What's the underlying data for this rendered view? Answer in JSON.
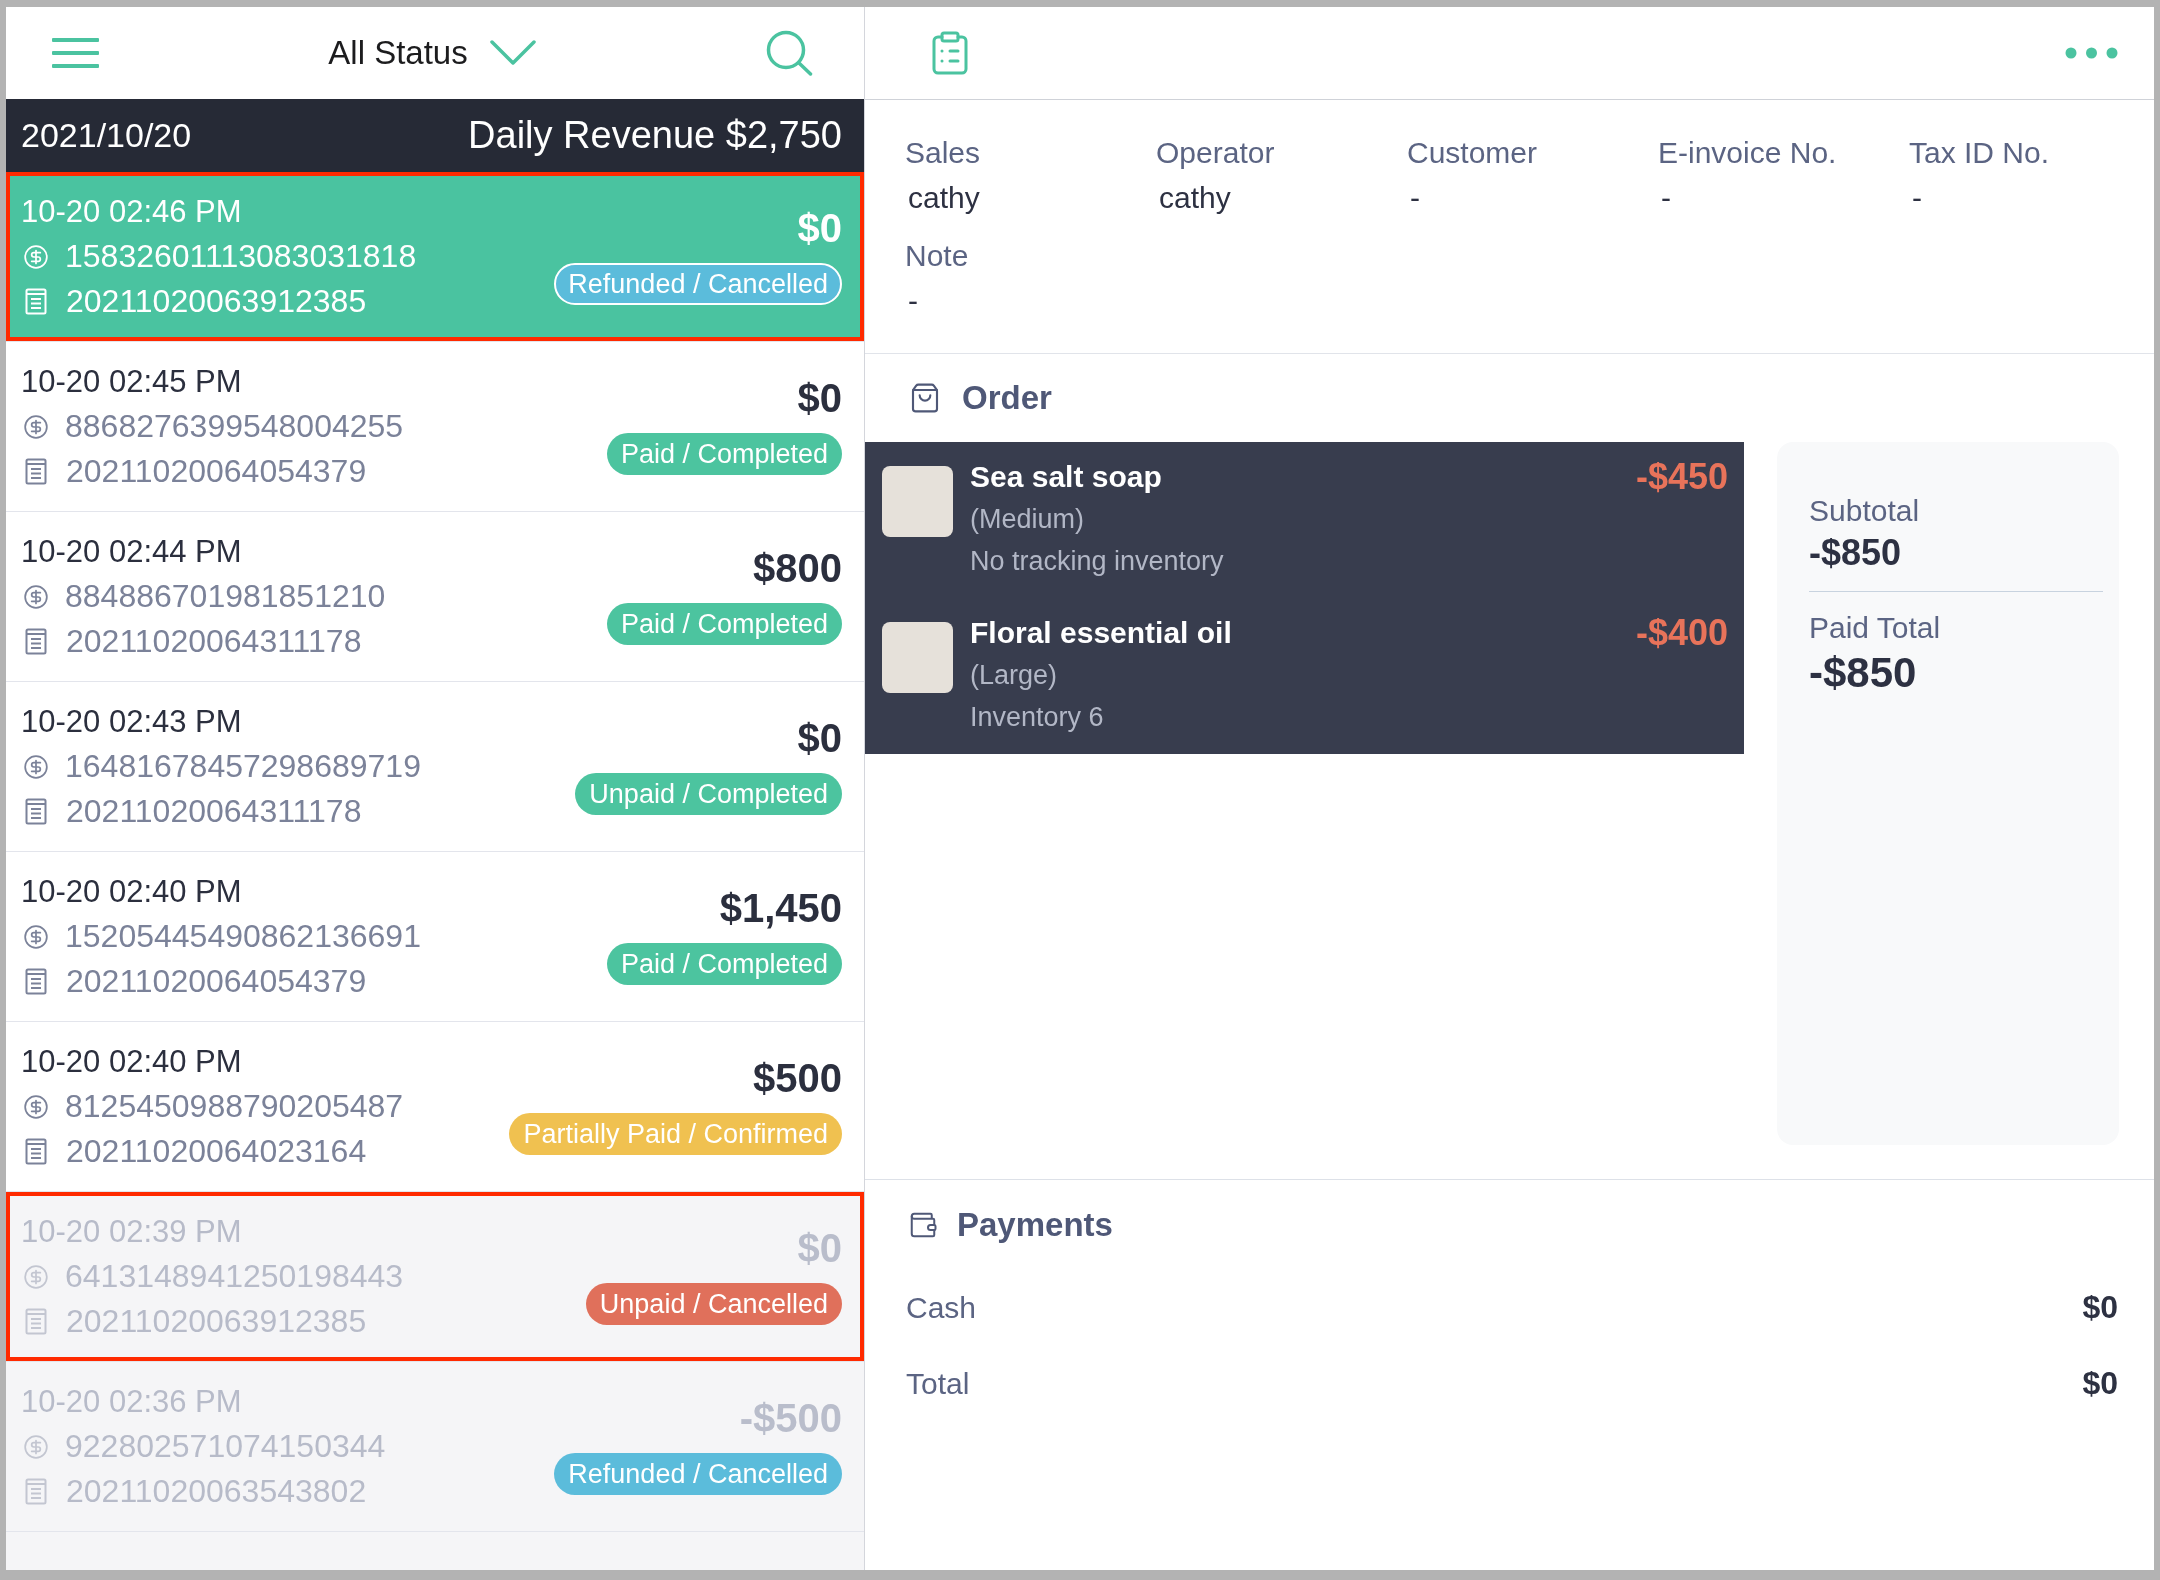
{
  "top_bar": {
    "filter": "All Status"
  },
  "date_bar": {
    "date": "2021/10/20",
    "revenue": "Daily Revenue $2,750"
  },
  "orders": [
    {
      "time": "10-20 02:46 PM",
      "payment_no": "15832601113083031818",
      "invoice_no": "20211020063912385",
      "amount": "$0",
      "status": {
        "label": "Refunded / Cancelled",
        "color": "#5bbcdb"
      },
      "selected": true,
      "dimmed": false,
      "outlined": true
    },
    {
      "time": "10-20 02:45 PM",
      "payment_no": "8868276399548004255",
      "invoice_no": "20211020064054379",
      "amount": "$0",
      "status": {
        "label": "Paid / Completed",
        "color": "#4cc49f"
      },
      "selected": false,
      "dimmed": false,
      "outlined": false
    },
    {
      "time": "10-20 02:44 PM",
      "payment_no": "884886701981851210",
      "invoice_no": "20211020064311178",
      "amount": "$800",
      "status": {
        "label": "Paid / Completed",
        "color": "#4cc49f"
      },
      "selected": false,
      "dimmed": false,
      "outlined": false
    },
    {
      "time": "10-20 02:43 PM",
      "payment_no": "16481678457298689719",
      "invoice_no": "20211020064311178",
      "amount": "$0",
      "status": {
        "label": "Unpaid / Completed",
        "color": "#4cc49f"
      },
      "selected": false,
      "dimmed": false,
      "outlined": false
    },
    {
      "time": "10-20 02:40 PM",
      "payment_no": "15205445490862136691",
      "invoice_no": "20211020064054379",
      "amount": "$1,450",
      "status": {
        "label": "Paid / Completed",
        "color": "#4cc49f"
      },
      "selected": false,
      "dimmed": false,
      "outlined": false
    },
    {
      "time": "10-20 02:40 PM",
      "payment_no": "8125450988790205487",
      "invoice_no": "20211020064023164",
      "amount": "$500",
      "status": {
        "label": "Partially Paid / Confirmed",
        "color": "#f0c150"
      },
      "selected": false,
      "dimmed": false,
      "outlined": false
    },
    {
      "time": "10-20 02:39 PM",
      "payment_no": "6413148941250198443",
      "invoice_no": "20211020063912385",
      "amount": "$0",
      "status": {
        "label": "Unpaid / Cancelled",
        "color": "#e0705b"
      },
      "selected": false,
      "dimmed": true,
      "outlined": true
    },
    {
      "time": "10-20 02:36 PM",
      "payment_no": "922802571074150344",
      "invoice_no": "20211020063543802",
      "amount": "-$500",
      "status": {
        "label": "Refunded / Cancelled",
        "color": "#5bbcdb"
      },
      "selected": false,
      "dimmed": true,
      "outlined": false
    }
  ],
  "details": {
    "fields": [
      {
        "label": "Sales",
        "value": "cathy"
      },
      {
        "label": "Operator",
        "value": "cathy"
      },
      {
        "label": "Customer",
        "value": "-"
      },
      {
        "label": "E-invoice No.",
        "value": "-"
      },
      {
        "label": "Tax ID No.",
        "value": "-"
      },
      {
        "label": "Note",
        "value": "-"
      }
    ]
  },
  "order": {
    "title": "Order",
    "items": [
      {
        "name": "Sea salt soap",
        "variant": "(Medium)",
        "stock": "No tracking inventory",
        "price": "-$450"
      },
      {
        "name": "Floral essential oil",
        "variant": "(Large)",
        "stock": "Inventory 6",
        "price": "-$400"
      }
    ],
    "summary": [
      {
        "kind": "subtotal",
        "label": "Subtotal",
        "value": "-$850"
      },
      {
        "kind": "total",
        "label": "Paid Total",
        "value": "-$850"
      }
    ]
  },
  "payments": {
    "title": "Payments",
    "rows": [
      {
        "label": "Cash",
        "value": "$0"
      },
      {
        "label": "Total",
        "value": "$0"
      }
    ]
  }
}
